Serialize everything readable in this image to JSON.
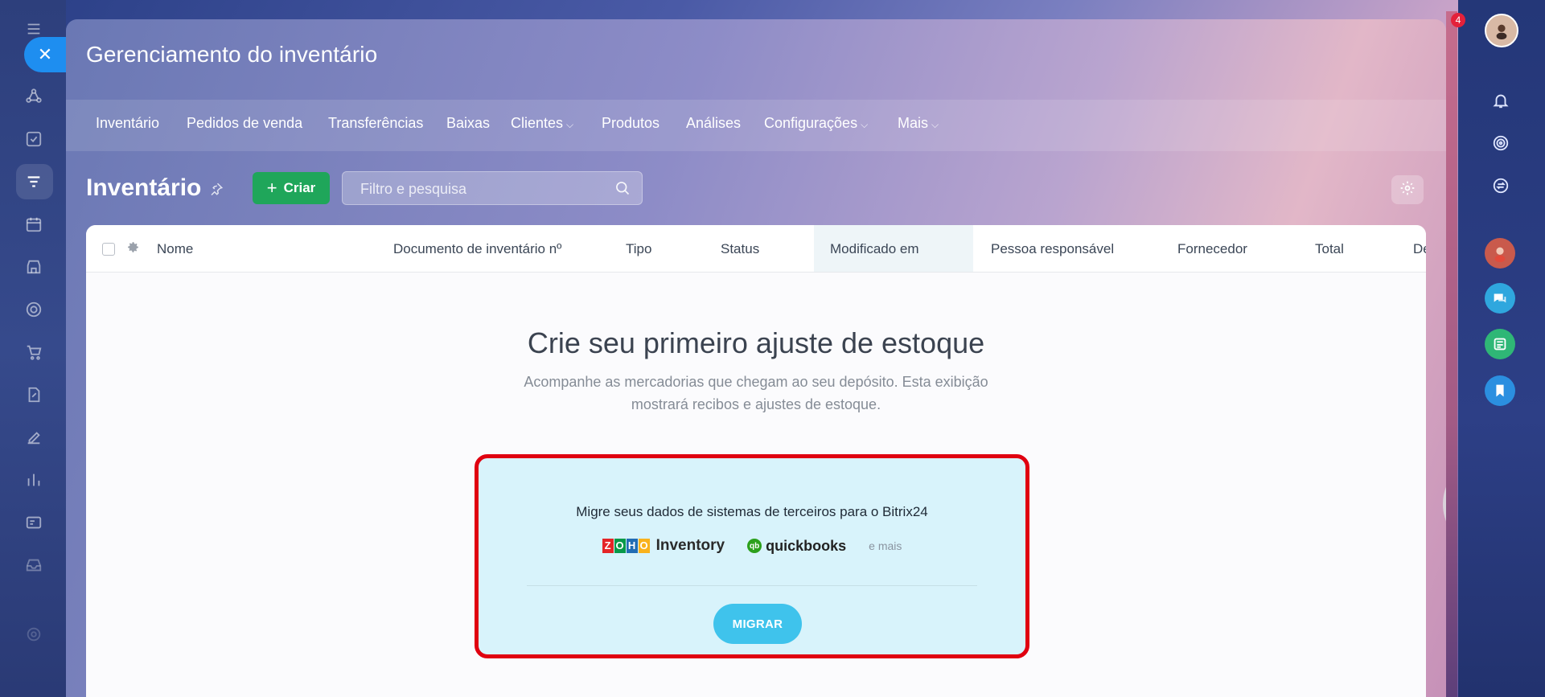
{
  "app": {
    "window_title": "Gerenciamento do inventário"
  },
  "nav": {
    "items": [
      {
        "label": "Inventário",
        "dropdown": false
      },
      {
        "label": "Pedidos de venda",
        "dropdown": false
      },
      {
        "label": "Transferências",
        "dropdown": false
      },
      {
        "label": "Baixas",
        "dropdown": false
      },
      {
        "label": "Clientes",
        "dropdown": true
      },
      {
        "label": "Produtos",
        "dropdown": false
      },
      {
        "label": "Análises",
        "dropdown": false
      },
      {
        "label": "Configurações",
        "dropdown": true
      },
      {
        "label": "Mais",
        "dropdown": true
      }
    ]
  },
  "toolbar": {
    "page_title": "Inventário",
    "create_label": "Criar",
    "search_placeholder": "Filtro e pesquisa"
  },
  "table": {
    "columns": [
      "Nome",
      "Documento de inventário nº",
      "Tipo",
      "Status",
      "Modificado em",
      "Pessoa responsável",
      "Fornecedor",
      "Total",
      "De"
    ],
    "highlighted_column": "Modificado em"
  },
  "empty_state": {
    "title": "Crie seu primeiro ajuste de estoque",
    "description": "Acompanhe as mercadorias que chegam ao seu depósito. Esta exibição mostrará recibos e ajustes de estoque."
  },
  "migration": {
    "text": "Migre seus dados de sistemas de terceiros para o Bitrix24",
    "logos": {
      "zoho_letters": [
        "Z",
        "O",
        "H",
        "O"
      ],
      "zoho_product": "Inventory",
      "qb_mark": "qb",
      "qb_brand": "quickbooks"
    },
    "more_label": "e mais",
    "button_label": "MIGRAR"
  },
  "notifications": {
    "count": "4"
  },
  "colors": {
    "accent_green": "#1fa65a",
    "migrate_button": "#3fc3ec",
    "highlight_border": "#e00010",
    "close_button": "#1e8ef0"
  }
}
